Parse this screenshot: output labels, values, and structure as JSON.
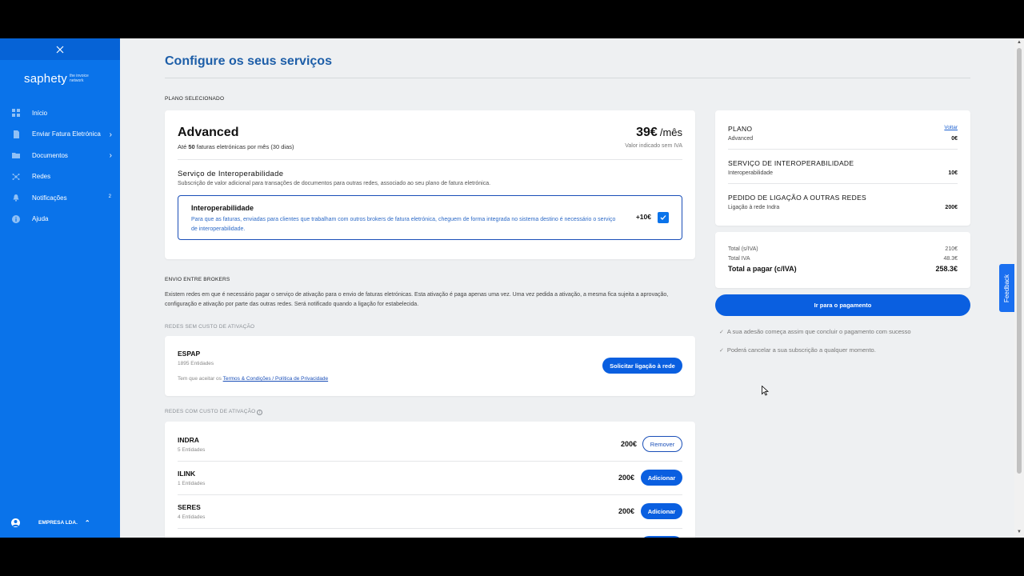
{
  "sidebar": {
    "logo": "saphety",
    "logo_tagline": "the invoice network",
    "items": [
      {
        "label": "Início",
        "icon": "grid-icon"
      },
      {
        "label": "Enviar Fatura Eletrónica",
        "icon": "document-icon"
      },
      {
        "label": "Documentos",
        "icon": "folder-icon"
      },
      {
        "label": "Redes",
        "icon": "network-icon"
      },
      {
        "label": "Notificações",
        "icon": "bell-icon",
        "badge": "2"
      },
      {
        "label": "Ajuda",
        "icon": "info-icon"
      }
    ],
    "user": "EMPRESA LDA."
  },
  "page": {
    "title": "Configure os seus serviços",
    "plan_section_label": "PLANO SELECIONADO"
  },
  "plan": {
    "name": "Advanced",
    "sub_prefix": "Até ",
    "sub_count": "50",
    "sub_suffix": " faturas eletrónicas por mês (30 dias)",
    "price": "39€",
    "per": "/mês",
    "vat_note": "Valor indicado sem IVA",
    "service_title": "Serviço de Interoperabilidade",
    "service_desc": "Subscrição de valor adicional para transações de documentos para outras redes, associado ao seu plano de fatura eletrónica.",
    "interop_title": "Interoperabilidade",
    "interop_desc": "Para que as faturas, enviadas para clientes que trabalham com outros brokers de fatura eletrónica, cheguem de forma integrada no sistema destino é necessário o serviço de interoperabilidade.",
    "interop_price": "+10€",
    "interop_checked": true
  },
  "brokers": {
    "section_label": "ENVIO ENTRE BROKERS",
    "desc": "Existem redes em que é necessário pagar o serviço de ativação para o envio de faturas eletrónicas. Esta ativação é paga apenas uma vez. Uma vez pedida a ativação, a mesma fica sujeita a aprovação, configuração e ativação por parte das outras redes. Será notificado quando a ligação for estabelecida.",
    "free_label": "REDES SEM CUSTO DE ATIVAÇÃO",
    "free_network": {
      "name": "ESPAP",
      "entities": "1895 Entidades",
      "terms_prefix": "Tem que aceitar os ",
      "terms_link": "Termos & Condições / Política de Privacidade",
      "button": "Solicitar ligação à rede"
    },
    "paid_label": "REDES COM CUSTO DE ATIVAÇÃO",
    "paid_networks": [
      {
        "name": "INDRA",
        "entities": "5 Entidades",
        "price": "200€",
        "button": "Remover"
      },
      {
        "name": "ILINK",
        "entities": "1 Entidades",
        "price": "200€",
        "button": "Adicionar"
      },
      {
        "name": "SERES",
        "entities": "4 Entidades",
        "price": "200€",
        "button": "Adicionar"
      }
    ]
  },
  "summary": {
    "plan_head": "PLANO",
    "back_link": "Voltar",
    "plan_name": "Advanced",
    "plan_value": "0€",
    "interop_head": "SERVIÇO DE INTEROPERABILIDADE",
    "interop_name": "Interoperabilidade",
    "interop_value": "10€",
    "link_head": "PEDIDO DE LIGAÇÃO A OUTRAS REDES",
    "link_name": "Ligação à rede Indra",
    "link_value": "200€",
    "total_net_label": "Total (s/IVA)",
    "total_net": "210€",
    "vat_label": "Total IVA",
    "vat": "48.3€",
    "total_label": "Total a pagar (c/IVA)",
    "total": "258.3€",
    "pay_button": "Ir para o pagamento",
    "note1": "A sua adesão começa assim que concluir o pagamento com sucesso",
    "note2": "Poderá cancelar a sua subscrição a qualquer momento."
  },
  "feedback_label": "Feedback",
  "colors": {
    "sidebar": "#0a73ea",
    "primary": "#0a5fe0",
    "title": "#1d5ea8",
    "background": "#eef0f2"
  }
}
